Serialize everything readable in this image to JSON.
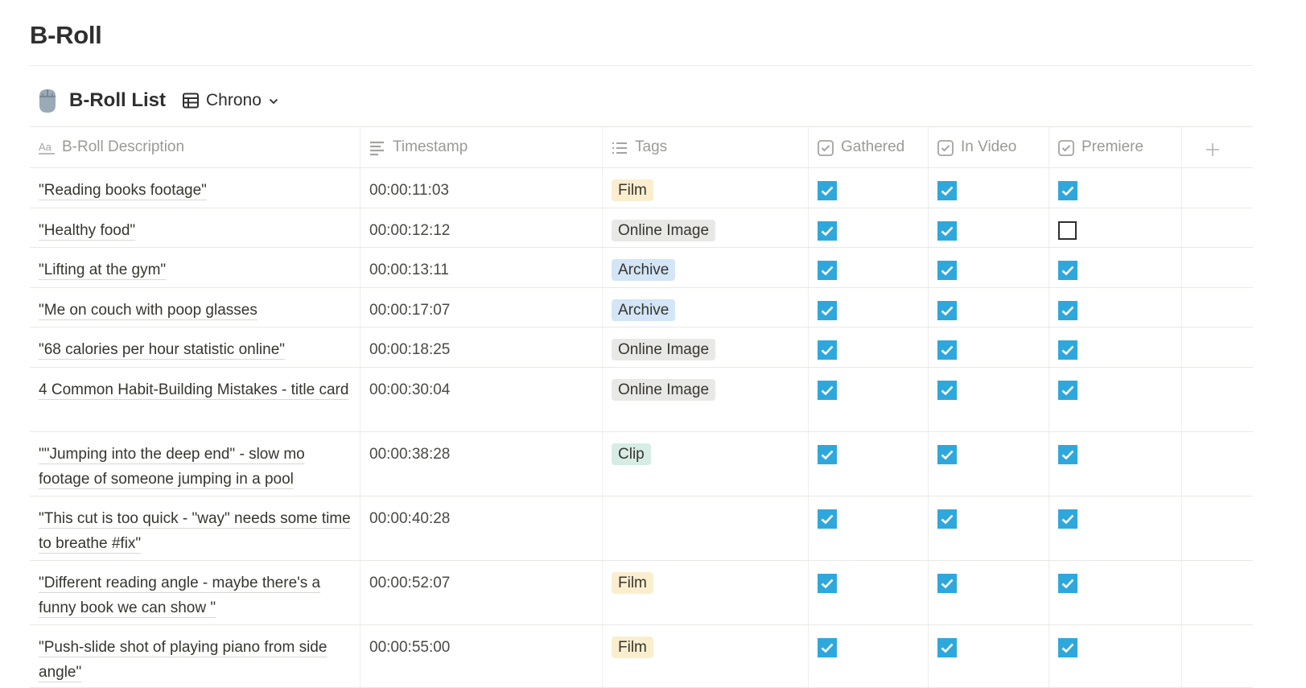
{
  "page": {
    "title": "B-Roll"
  },
  "database": {
    "icon": "computer-mouse-icon",
    "title": "B-Roll List",
    "view": {
      "icon": "table-icon",
      "label": "Chrono",
      "dropdown_icon": "chevron-down-icon"
    }
  },
  "colors": {
    "checkbox_checked": "#2ea8dc",
    "tag_film": "#fbeecf",
    "tag_online_image": "#e8e8e7",
    "tag_archive": "#d3e5f6",
    "tag_clip": "#d6ece5"
  },
  "columns": [
    {
      "label": "B-Roll Description",
      "icon": "text-title-icon"
    },
    {
      "label": "Timestamp",
      "icon": "text-lines-icon"
    },
    {
      "label": "Tags",
      "icon": "multi-select-list-icon"
    },
    {
      "label": "Gathered",
      "icon": "checkbox-icon"
    },
    {
      "label": "In Video",
      "icon": "checkbox-icon"
    },
    {
      "label": "Premiere",
      "icon": "checkbox-icon"
    },
    {
      "label": "+",
      "icon": "add-property-icon"
    }
  ],
  "rows": [
    {
      "description": "\"Reading books footage\"",
      "timestamp": "00:00:11:03",
      "tag": "Film",
      "gathered": true,
      "in_video": true,
      "premiere": true
    },
    {
      "description": "\"Healthy food\"",
      "timestamp": "00:00:12:12",
      "tag": "Online Image",
      "gathered": true,
      "in_video": true,
      "premiere": false
    },
    {
      "description": "\"Lifting at the gym\"",
      "timestamp": "00:00:13:11",
      "tag": "Archive",
      "gathered": true,
      "in_video": true,
      "premiere": true
    },
    {
      "description": "\"Me on couch with poop glasses",
      "timestamp": "00:00:17:07",
      "tag": "Archive",
      "gathered": true,
      "in_video": true,
      "premiere": true
    },
    {
      "description": "\"68 calories per hour statistic online\"",
      "timestamp": "00:00:18:25",
      "tag": "Online Image",
      "gathered": true,
      "in_video": true,
      "premiere": true
    },
    {
      "description": "4 Common Habit-Building Mistakes - title card",
      "timestamp": "00:00:30:04",
      "tag": "Online Image",
      "gathered": true,
      "in_video": true,
      "premiere": true
    },
    {
      "description": "\"\"Jumping into the deep end\" - slow mo footage of someone jumping in a pool",
      "timestamp": "00:00:38:28",
      "tag": "Clip",
      "gathered": true,
      "in_video": true,
      "premiere": true
    },
    {
      "description": "\"This cut is too quick - \"way\" needs some time to breathe #fix\"",
      "timestamp": "00:00:40:28",
      "tag": "",
      "gathered": true,
      "in_video": true,
      "premiere": true
    },
    {
      "description": "\"Different reading angle - maybe there's a funny book we can show \"",
      "timestamp": "00:00:52:07",
      "tag": "Film",
      "gathered": true,
      "in_video": true,
      "premiere": true
    },
    {
      "description": "\"Push-slide shot of playing piano from side angle\"",
      "timestamp": "00:00:55:00",
      "tag": "Film",
      "gathered": true,
      "in_video": true,
      "premiere": true
    }
  ]
}
